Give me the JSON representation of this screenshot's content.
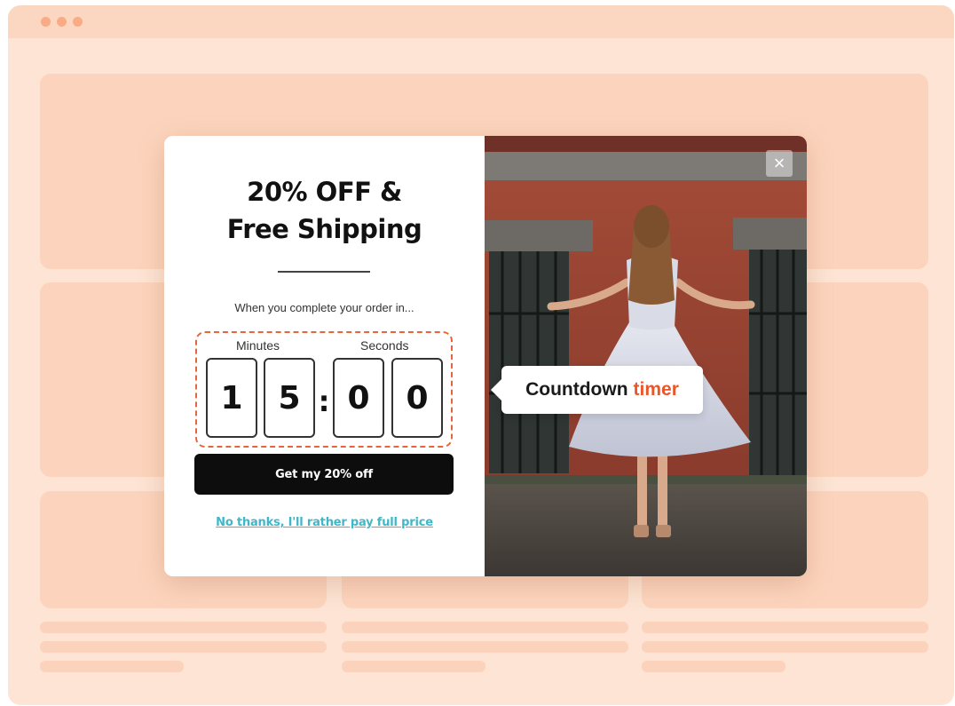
{
  "popup": {
    "headline_line1": "20% OFF &",
    "headline_line2": "Free Shipping",
    "subtext": "When you complete your order in...",
    "timer": {
      "minutes_label": "Minutes",
      "seconds_label": "Seconds",
      "digits": [
        "1",
        "5",
        "0",
        "0"
      ],
      "separator": ":"
    },
    "cta_label": "Get my 20% off",
    "decline_label": "No thanks, I'll rather pay full price",
    "close_symbol": "×"
  },
  "callout": {
    "text": "Countdown",
    "accent_text": "timer"
  },
  "colors": {
    "page_background": "#fde4d4",
    "skeleton": "#fcd4bd",
    "accent_orange": "#e8562b",
    "link_teal": "#3fb7c9",
    "cta_black": "#0d0d0d"
  }
}
